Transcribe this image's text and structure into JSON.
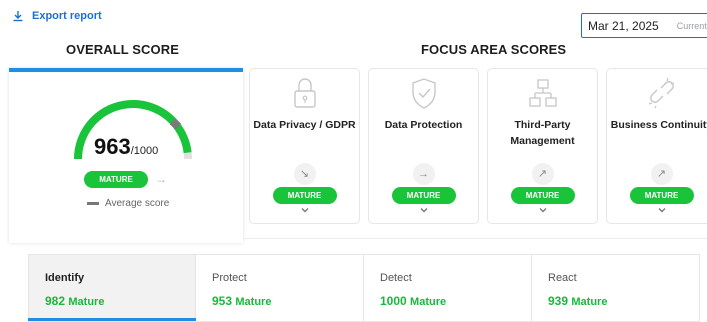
{
  "toolbar": {
    "export_label": "Export report"
  },
  "date_filter": {
    "value": "Mar 21, 2025",
    "sub_label": "Current"
  },
  "headings": {
    "overall": "OVERALL SCORE",
    "focus": "FOCUS AREA SCORES"
  },
  "overall": {
    "score": "963",
    "denominator": "/1000",
    "gauge_fraction": 0.963,
    "status": "MATURE",
    "average_label": "Average score",
    "accent_color": "#19c43a"
  },
  "focus_areas": [
    {
      "title": "Data Privacy / GDPR",
      "icon": "lock-icon",
      "trend": "↘",
      "status": "MATURE"
    },
    {
      "title": "Data Protection",
      "icon": "shield-check-icon",
      "trend": "→",
      "status": "MATURE"
    },
    {
      "title": "Third-Party Management",
      "icon": "org-chart-icon",
      "trend": "↗",
      "status": "MATURE"
    },
    {
      "title": "Business Continuity",
      "icon": "broken-link-icon",
      "trend": "↗",
      "status": "MATURE"
    }
  ],
  "tabs": [
    {
      "name": "Identify",
      "score": "982",
      "label": "Mature",
      "active": true
    },
    {
      "name": "Protect",
      "score": "953",
      "label": "Mature",
      "active": false
    },
    {
      "name": "Detect",
      "score": "1000",
      "label": "Mature",
      "active": false
    },
    {
      "name": "React",
      "score": "939",
      "label": "Mature",
      "active": false
    }
  ]
}
